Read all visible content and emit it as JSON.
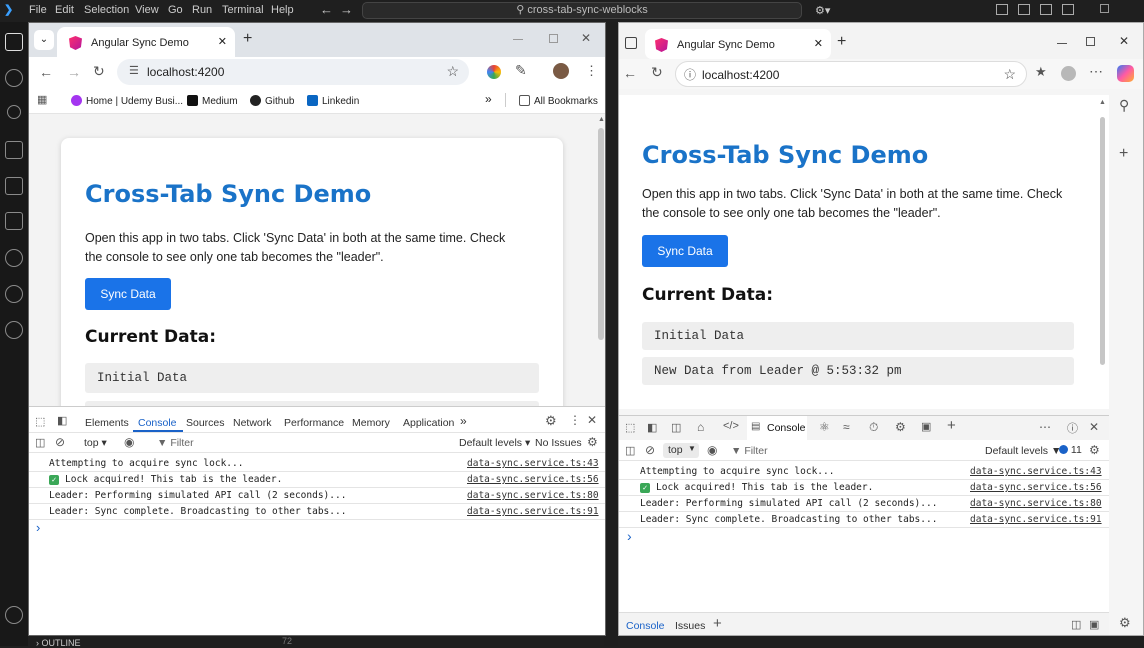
{
  "vscode": {
    "menu": [
      "File",
      "Edit",
      "Selection",
      "View",
      "Go",
      "Run",
      "Terminal",
      "Help"
    ],
    "search": "cross-tab-sync-weblocks",
    "outline": "OUTLINE",
    "line_number": "72"
  },
  "chrome": {
    "tab_title": "Angular Sync Demo",
    "new_tab": "+",
    "address": "localhost:4200",
    "bookmarks": [
      "Home | Udemy Busi...",
      "Medium",
      "Github",
      "Linkedin"
    ],
    "more_bookmarks": "»",
    "all_bookmarks": "All Bookmarks"
  },
  "page": {
    "title": "Cross-Tab Sync Demo",
    "description": "Open this app in two tabs. Click 'Sync Data' in both at the same time. Check the console to see only one tab becomes the \"leader\".",
    "button": "Sync Data",
    "current_data_heading": "Current Data:",
    "data_items": [
      "Initial Data",
      "New Data from Leader @ 5:53:32 pm"
    ]
  },
  "chrome_devtools": {
    "tabs": [
      "Elements",
      "Console",
      "Sources",
      "Network",
      "Performance",
      "Memory",
      "Application"
    ],
    "active_tab": "Console",
    "context": "top ▾",
    "filter_placeholder": "Filter",
    "levels": "Default levels ▾",
    "issues": "No Issues"
  },
  "edge_devtools": {
    "active_tab": "Console",
    "context": "top",
    "filter_placeholder": "Filter",
    "levels": "Default levels",
    "issue_count": "11",
    "drawer_tabs": [
      "Console",
      "Issues"
    ]
  },
  "console_logs": [
    {
      "text": "Attempting to acquire sync lock...",
      "source": "data-sync.service.ts:43",
      "check": false
    },
    {
      "text": "Lock acquired! This tab is the leader.",
      "source": "data-sync.service.ts:56",
      "check": true
    },
    {
      "text": "Leader: Performing simulated API call (2 seconds)...",
      "source": "data-sync.service.ts:80",
      "check": false
    },
    {
      "text": "Leader: Sync complete. Broadcasting to other tabs...",
      "source": "data-sync.service.ts:91",
      "check": false
    }
  ],
  "prompt": "›",
  "colors": {
    "accent": "#1a73e8",
    "title_blue": "#1a73c8",
    "angular": "#dd0031"
  }
}
